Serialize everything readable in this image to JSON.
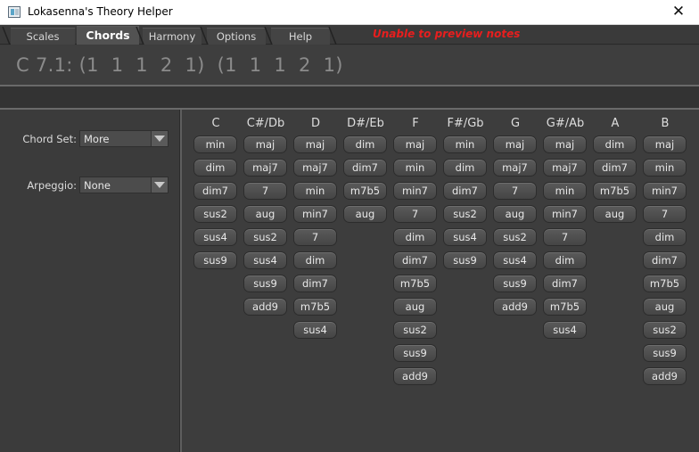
{
  "window": {
    "title": "Lokasenna's Theory Helper",
    "close_glyph": "✕"
  },
  "tabs": [
    "Scales",
    "Chords",
    "Harmony",
    "Options",
    "Help"
  ],
  "active_tab": "Chords",
  "warning": "Unable to preview notes",
  "header": {
    "text": "C 7.1: (1  1  1  2  1)  (1  1  1  2  1)"
  },
  "settings": {
    "chord_set": {
      "label": "Chord Set:",
      "value": "More"
    },
    "arpeggio": {
      "label": "Arpeggio:",
      "value": "None"
    }
  },
  "chords": {
    "columns": [
      {
        "root": "C",
        "items": [
          "min",
          "dim",
          "dim7",
          "sus2",
          "sus4",
          "sus9"
        ]
      },
      {
        "root": "C#/Db",
        "items": [
          "maj",
          "maj7",
          "7",
          "aug",
          "sus2",
          "sus4",
          "sus9",
          "add9"
        ]
      },
      {
        "root": "D",
        "items": [
          "maj",
          "maj7",
          "min",
          "min7",
          "7",
          "dim",
          "dim7",
          "m7b5",
          "sus4"
        ]
      },
      {
        "root": "D#/Eb",
        "items": [
          "dim",
          "dim7",
          "m7b5",
          "aug"
        ]
      },
      {
        "root": "F",
        "items": [
          "maj",
          "min",
          "min7",
          "7",
          "dim",
          "dim7",
          "m7b5",
          "aug",
          "sus2",
          "sus9",
          "add9"
        ]
      },
      {
        "root": "F#/Gb",
        "items": [
          "min",
          "dim",
          "dim7",
          "sus2",
          "sus4",
          "sus9"
        ]
      },
      {
        "root": "G",
        "items": [
          "maj",
          "maj7",
          "7",
          "aug",
          "sus2",
          "sus4",
          "sus9",
          "add9"
        ]
      },
      {
        "root": "G#/Ab",
        "items": [
          "maj",
          "maj7",
          "min",
          "min7",
          "7",
          "dim",
          "dim7",
          "m7b5",
          "sus4"
        ]
      },
      {
        "root": "A",
        "items": [
          "dim",
          "dim7",
          "m7b5",
          "aug"
        ]
      },
      {
        "root": "B",
        "items": [
          "maj",
          "min",
          "min7",
          "7",
          "dim",
          "dim7",
          "m7b5",
          "aug",
          "sus2",
          "sus9",
          "add9"
        ]
      }
    ]
  },
  "colors": {
    "warning": "#e81e1e",
    "background": "#3c3c3c",
    "chip": "#4f4f4f"
  }
}
